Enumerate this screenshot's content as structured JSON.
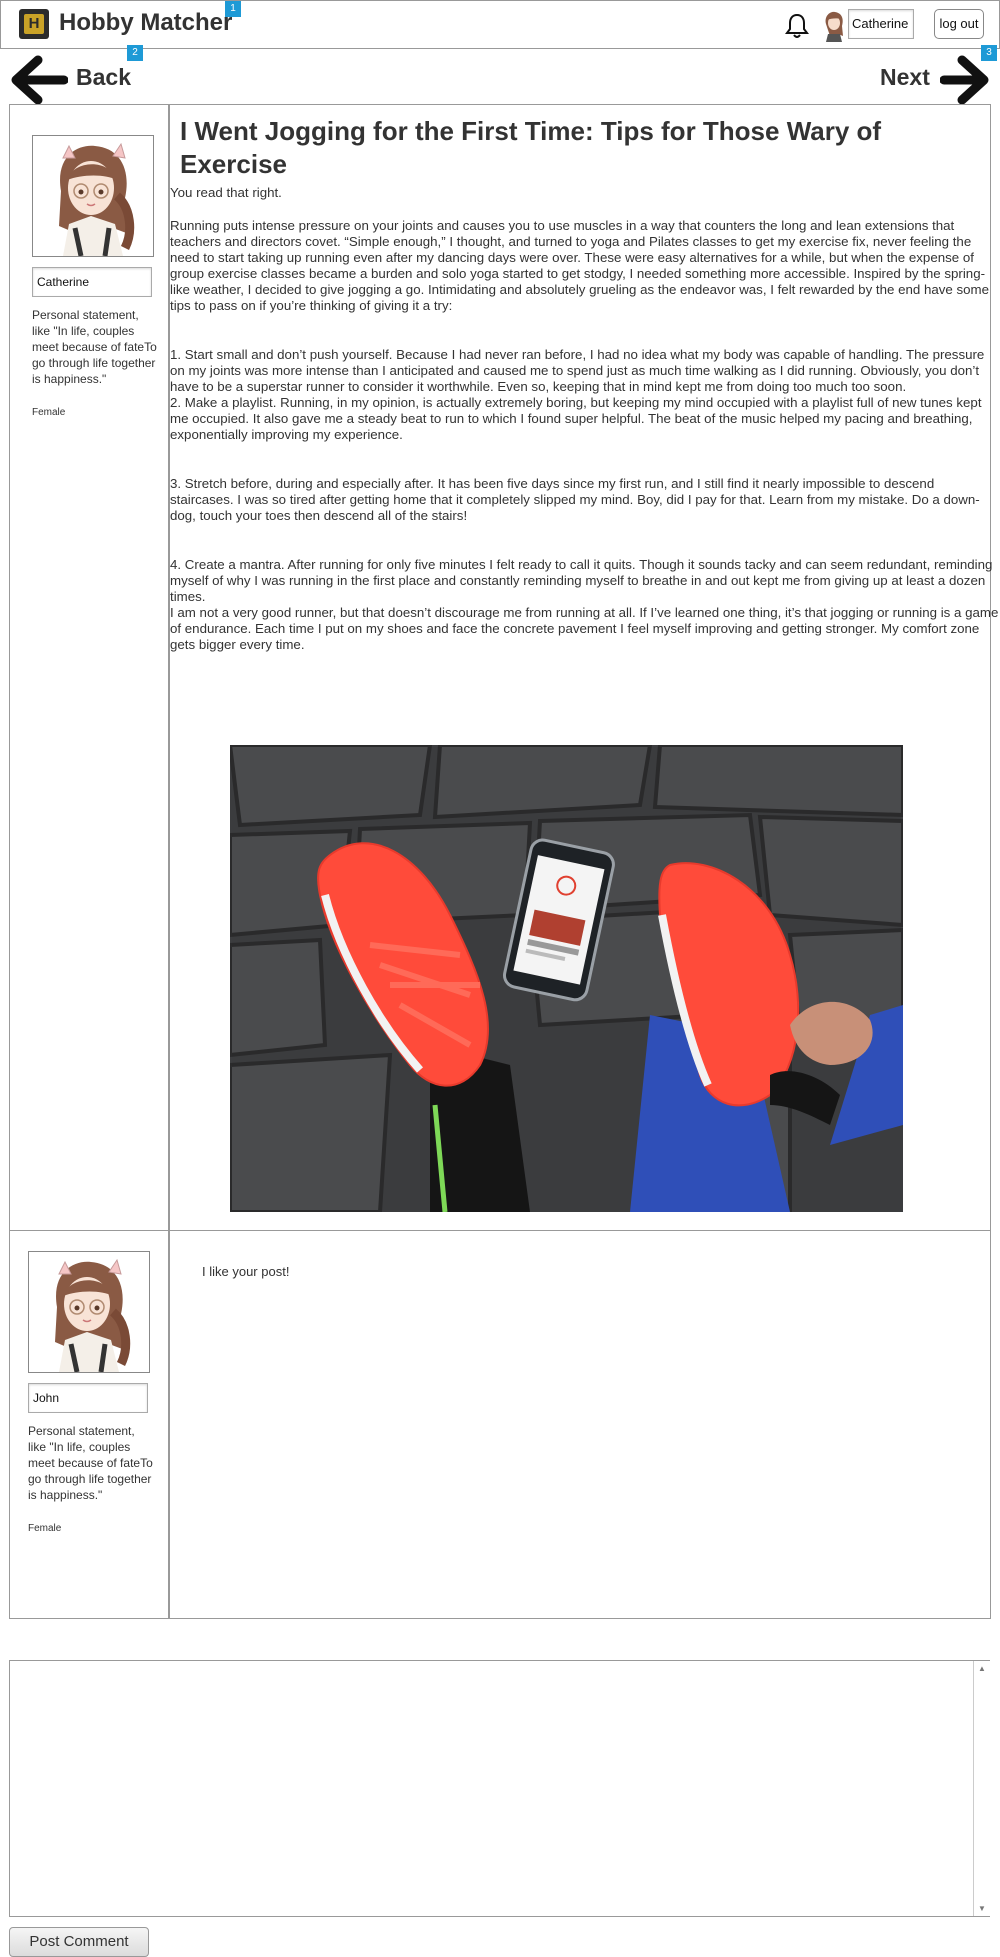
{
  "header": {
    "app_title": "Hobby Matcher",
    "username": "Catherine",
    "logout_label": "log out",
    "notification_icon": "bell-icon",
    "logo_icon": "hobby-matcher-logo"
  },
  "markers": [
    "1",
    "2",
    "3"
  ],
  "nav": {
    "back_label": "Back",
    "next_label": "Next"
  },
  "author": {
    "name": "Catherine",
    "statement": "Personal statement, like \"In life, couples meet because of fateTo go through life together is happiness.\"",
    "gender": "Female"
  },
  "article": {
    "title": "I Went Jogging for the First Time: Tips for Those Wary of Exercise",
    "intro": "You read that right.",
    "p1": "Running puts intense pressure on your joints and causes you to use muscles in a way that counters the long and lean extensions that teachers and directors covet. “Simple enough,” I thought, and turned to yoga and Pilates classes to get my exercise fix, never feeling the need to start taking up running even after my dancing days were over. These were easy alternatives for a while, but when the expense of group exercise classes became a burden and solo yoga started to get stodgy, I needed something more accessible. Inspired by the spring-like weather, I decided to give jogging a go. Intimidating and absolutely grueling as the endeavor was, I felt rewarded by the end have some tips to pass on if you’re thinking of giving it a try:",
    "tip1": "1. Start small and don’t push yourself. Because I had never ran before, I had no idea what my body was capable of handling. The pressure on my joints was more intense than I anticipated and caused me to spend just as much time walking as I did running. Obviously, you don’t have to be a superstar runner to consider it worthwhile. Even so, keeping that in mind kept me from doing too much too soon.",
    "tip2": "2. Make a playlist. Running, in my opinion, is actually extremely boring, but keeping my mind occupied with a playlist full of new tunes kept me occupied. It also gave me a steady beat to run to which I found super helpful. The beat of the music helped my pacing and breathing, exponentially improving my experience.",
    "tip3": "3. Stretch before, during and especially after. It has been five days since my first run, and I still find it nearly impossible to descend staircases. I was so tired after getting home that it completely slipped my mind. Boy, did I pay for that. Learn from my mistake. Do a down-dog, touch your toes then descend all of the stairs!",
    "tip4": "4. Create a mantra. After running for only five minutes I felt ready to call it quits. Though it sounds tacky and can seem redundant, reminding myself of why I was running in the first place and constantly reminding myself to breathe in and out kept me from giving up at least a dozen times.",
    "closing": "I am not a very good runner, but that doesn’t discourage me from running at all. If I’ve learned one thing, it’s that jogging or running is a game of endurance. Each time I put on my shoes and face the concrete pavement I feel myself improving and getting stronger. My comfort zone gets bigger every time.",
    "photo": "running-shoes-photo"
  },
  "comment": {
    "name": "John",
    "statement": "Personal statement, like \"In life, couples meet because of fateTo go through life together is happiness.\"",
    "gender": "Female",
    "text": "I like your post!"
  },
  "comment_form": {
    "value": "",
    "button_label": "Post Comment"
  },
  "colors": {
    "marker": "#1e9ad6",
    "border": "#999999",
    "shoe": "#ff4b3a",
    "text": "#333333"
  }
}
